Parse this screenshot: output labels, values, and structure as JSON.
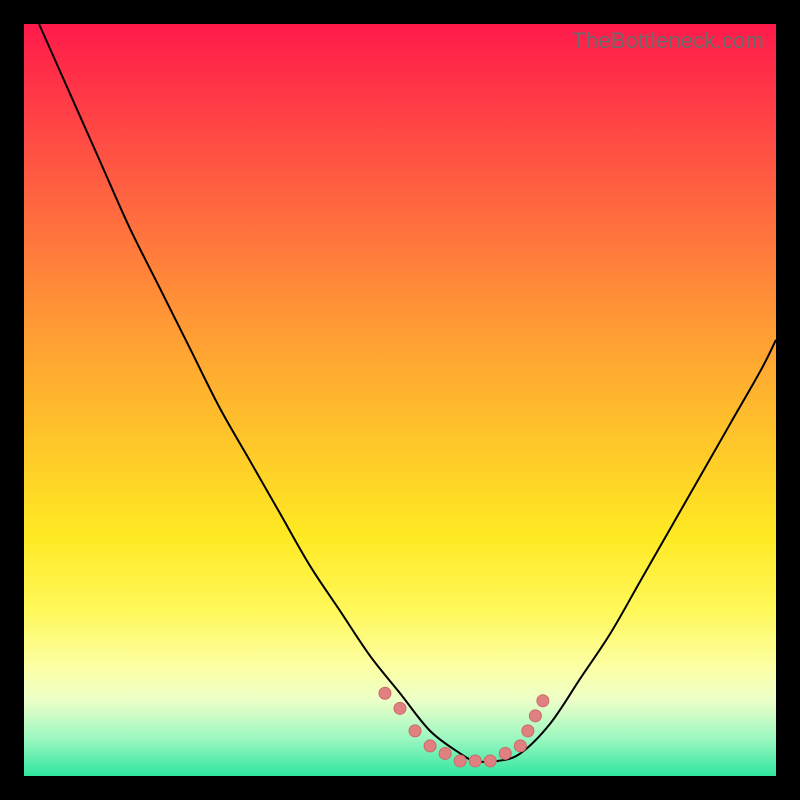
{
  "watermark": "TheBottleneck.com",
  "chart_data": {
    "type": "line",
    "title": "",
    "xlabel": "",
    "ylabel": "",
    "xlim": [
      0,
      100
    ],
    "ylim": [
      0,
      100
    ],
    "background_gradient": {
      "direction": "vertical",
      "stops": [
        {
          "pos": 0,
          "color": "#ff1a4b"
        },
        {
          "pos": 25,
          "color": "#ff6a3f"
        },
        {
          "pos": 55,
          "color": "#ffc52a"
        },
        {
          "pos": 78,
          "color": "#fff85a"
        },
        {
          "pos": 90,
          "color": "#ecffc8"
        },
        {
          "pos": 100,
          "color": "#2fe6a0"
        }
      ]
    },
    "series": [
      {
        "name": "bottleneck-curve",
        "x": [
          2,
          6,
          10,
          14,
          18,
          22,
          26,
          30,
          34,
          38,
          42,
          46,
          50,
          54,
          58,
          60,
          63,
          66,
          70,
          74,
          78,
          82,
          86,
          90,
          94,
          98,
          100
        ],
        "y": [
          100,
          91,
          82,
          73,
          65,
          57,
          49,
          42,
          35,
          28,
          22,
          16,
          11,
          6,
          3,
          2,
          2,
          3,
          7,
          13,
          19,
          26,
          33,
          40,
          47,
          54,
          58
        ]
      }
    ],
    "markers": {
      "name": "highlight-points",
      "color": "#e08080",
      "points": [
        {
          "x": 48,
          "y": 11
        },
        {
          "x": 50,
          "y": 9
        },
        {
          "x": 52,
          "y": 6
        },
        {
          "x": 54,
          "y": 4
        },
        {
          "x": 56,
          "y": 3
        },
        {
          "x": 58,
          "y": 2
        },
        {
          "x": 60,
          "y": 2
        },
        {
          "x": 62,
          "y": 2
        },
        {
          "x": 64,
          "y": 3
        },
        {
          "x": 66,
          "y": 4
        },
        {
          "x": 67,
          "y": 6
        },
        {
          "x": 68,
          "y": 8
        },
        {
          "x": 69,
          "y": 10
        }
      ]
    }
  }
}
